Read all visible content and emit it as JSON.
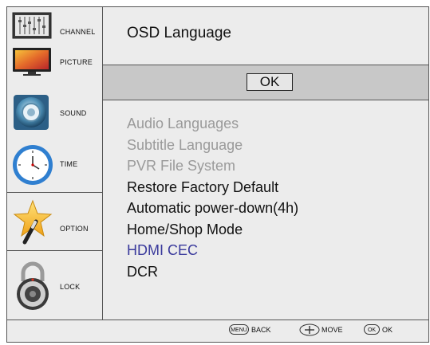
{
  "sidebar": {
    "items": [
      {
        "label": "CHANNEL",
        "icon": "channel-grid-icon"
      },
      {
        "label": "PICTURE",
        "icon": "tv-picture-icon"
      },
      {
        "label": "SOUND",
        "icon": "speaker-icon"
      },
      {
        "label": "TIME",
        "icon": "clock-icon"
      },
      {
        "label": "OPTION",
        "icon": "star-wand-icon"
      },
      {
        "label": "LOCK",
        "icon": "padlock-icon"
      }
    ]
  },
  "main": {
    "title": "OSD Language",
    "ok_label": "OK",
    "menu": [
      {
        "label": "Audio Languages",
        "state": "disabled"
      },
      {
        "label": "Subtitle Language",
        "state": "disabled"
      },
      {
        "label": "PVR File System",
        "state": "disabled"
      },
      {
        "label": "Restore Factory Default",
        "state": "normal"
      },
      {
        "label": "Automatic power-down(4h)",
        "state": "normal"
      },
      {
        "label": "Home/Shop Mode",
        "state": "normal"
      },
      {
        "label": "HDMI CEC",
        "state": "selected"
      },
      {
        "label": "DCR",
        "state": "normal"
      }
    ]
  },
  "footer": {
    "menu_key": "MENU",
    "back_label": "BACK",
    "move_label": "MOVE",
    "ok_key": "OK",
    "ok_label": "OK"
  },
  "colors": {
    "background": "#ececec",
    "ok_band": "#c8c8c8",
    "disabled_text": "#9a9a9a",
    "selected_text": "#3a3a9c"
  }
}
